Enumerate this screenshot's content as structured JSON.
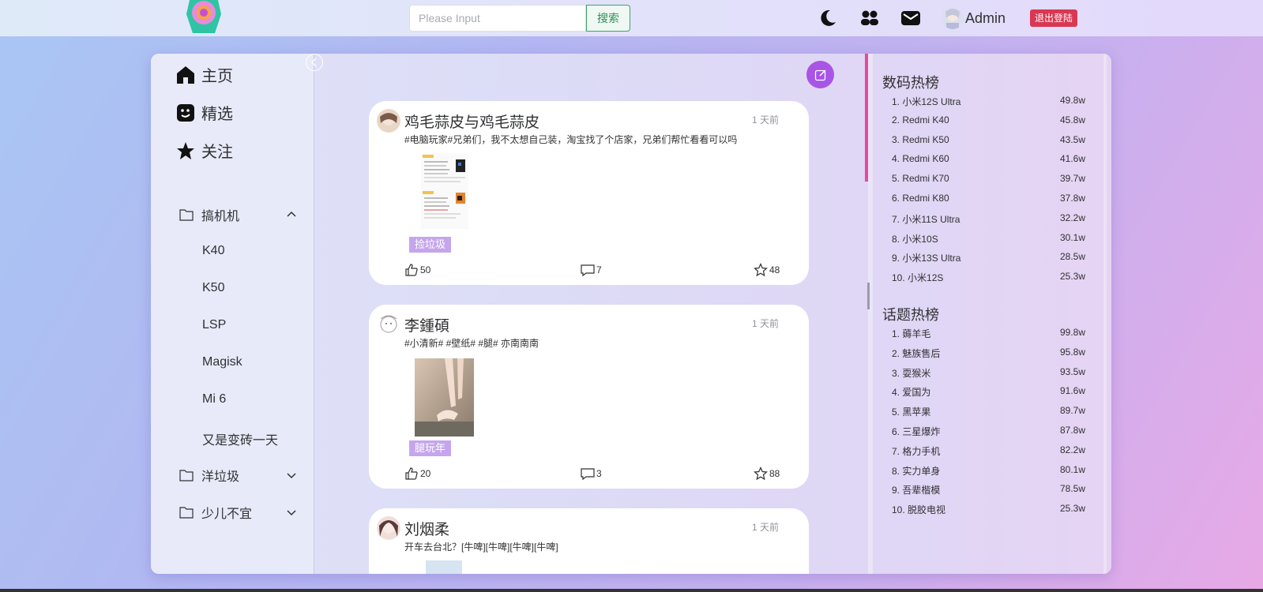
{
  "header": {
    "search_placeholder": "Please Input",
    "search_button": "搜索",
    "admin_name": "Admin",
    "logout_button": "退出登陆"
  },
  "sidebar": {
    "main_nav": [
      {
        "label": "主页",
        "icon": "home-icon"
      },
      {
        "label": "精选",
        "icon": "featured-icon"
      },
      {
        "label": "关注",
        "icon": "star-icon"
      }
    ],
    "folders": [
      {
        "label": "搞机机",
        "expanded": true,
        "children": [
          "K40",
          "K50",
          "LSP",
          "Magisk",
          "Mi 6",
          "又是变砖一天"
        ]
      },
      {
        "label": "洋垃圾",
        "expanded": false
      },
      {
        "label": "少儿不宜",
        "expanded": false
      }
    ]
  },
  "posts": [
    {
      "author": "鸡毛蒜皮与鸡毛蒜皮",
      "time": "1 天前",
      "content": "#电脑玩家#兄弟们，我不太想自己装，淘宝找了个店家，兄弟们帮忙看看可以吗",
      "tag": "捡垃圾",
      "likes": "50",
      "comments": "7",
      "stars": "48"
    },
    {
      "author": "李鍾碩",
      "time": "1 天前",
      "content": "#小清新# #壁纸# #腿# 亦南南南",
      "tag": "腿玩年",
      "likes": "20",
      "comments": "3",
      "stars": "88"
    },
    {
      "author": "刘烟柔",
      "time": "1 天前",
      "content": "开车去台北？[牛啤][牛啤][牛啤][牛啤]"
    }
  ],
  "hot_lists": {
    "digital": {
      "title": "数码热榜",
      "items": [
        {
          "rank": "1.",
          "name": "小米12S Ultra",
          "value": "49.8w"
        },
        {
          "rank": "2.",
          "name": "Redmi K40",
          "value": "45.8w"
        },
        {
          "rank": "3.",
          "name": "Redmi K50",
          "value": "43.5w"
        },
        {
          "rank": "4.",
          "name": "Redmi K60",
          "value": "41.6w"
        },
        {
          "rank": "5.",
          "name": "Redmi K70",
          "value": "39.7w"
        },
        {
          "rank": "6.",
          "name": "Redmi K80",
          "value": "37.8w"
        },
        {
          "rank": "7.",
          "name": "小米11S Ultra",
          "value": "32.2w"
        },
        {
          "rank": "8.",
          "name": "小米10S",
          "value": "30.1w"
        },
        {
          "rank": "9.",
          "name": "小米13S Ultra",
          "value": "28.5w"
        },
        {
          "rank": "10.",
          "name": "小米12S",
          "value": "25.3w"
        }
      ]
    },
    "topics": {
      "title": "话题热榜",
      "items": [
        {
          "rank": "1.",
          "name": "薅羊毛",
          "value": "99.8w"
        },
        {
          "rank": "2.",
          "name": "魅族售后",
          "value": "95.8w"
        },
        {
          "rank": "3.",
          "name": "耍猴米",
          "value": "93.5w"
        },
        {
          "rank": "4.",
          "name": "爱国为",
          "value": "91.6w"
        },
        {
          "rank": "5.",
          "name": "黑苹果",
          "value": "89.7w"
        },
        {
          "rank": "6.",
          "name": "三星爆炸",
          "value": "87.8w"
        },
        {
          "rank": "7.",
          "name": "格力手机",
          "value": "82.2w"
        },
        {
          "rank": "8.",
          "name": "实力单身",
          "value": "80.1w"
        },
        {
          "rank": "9.",
          "name": "吾辈楷模",
          "value": "78.5w"
        },
        {
          "rank": "10.",
          "name": "脱胶电视",
          "value": "25.3w"
        }
      ]
    }
  },
  "colors": {
    "accent_purple": "#a855e6",
    "tag_purple": "#c5a6ec",
    "logout_red": "#d93752",
    "rank_pink": "#e64a9c"
  }
}
